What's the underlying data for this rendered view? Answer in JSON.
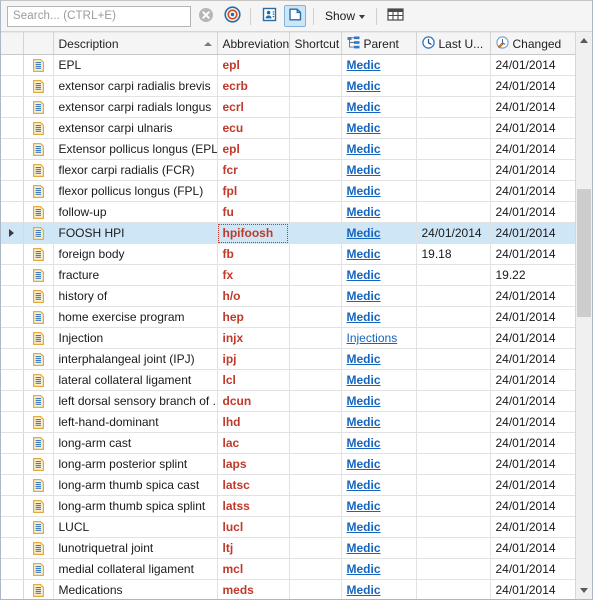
{
  "toolbar": {
    "search": {
      "placeholder": "Search... (CTRL+E)",
      "value": ""
    },
    "clear_icon": "clear-circle-icon",
    "target_icon": "target-icon",
    "contact_icon": "contact-card-icon",
    "document_icon": "document-folder-icon",
    "show_label": "Show",
    "columns_icon": "columns-grid-icon"
  },
  "grid": {
    "columns": [
      {
        "key": "indicator",
        "label": ""
      },
      {
        "key": "icon",
        "label": ""
      },
      {
        "key": "description",
        "label": "Description",
        "sorted": "asc"
      },
      {
        "key": "abbreviation",
        "label": "Abbreviation"
      },
      {
        "key": "shortcut",
        "label": "Shortcut"
      },
      {
        "key": "parent",
        "label": "Parent",
        "icon": "hierarchy-icon"
      },
      {
        "key": "last_updated",
        "label": "Last U...",
        "icon": "clock-icon"
      },
      {
        "key": "changed",
        "label": "Changed",
        "icon": "clock-edit-icon"
      }
    ],
    "rows": [
      {
        "description": "EPL",
        "abbreviation": "epl",
        "shortcut": "",
        "parent": "Medic",
        "last_updated": "",
        "changed": "24/01/2014",
        "selected": false
      },
      {
        "description": "extensor carpi radialis brevis",
        "abbreviation": "ecrb",
        "shortcut": "",
        "parent": "Medic",
        "last_updated": "",
        "changed": "24/01/2014",
        "selected": false
      },
      {
        "description": "extensor carpi radials longus",
        "abbreviation": "ecrl",
        "shortcut": "",
        "parent": "Medic",
        "last_updated": "",
        "changed": "24/01/2014",
        "selected": false
      },
      {
        "description": "extensor carpi ulnaris",
        "abbreviation": "ecu",
        "shortcut": "",
        "parent": "Medic",
        "last_updated": "",
        "changed": "24/01/2014",
        "selected": false
      },
      {
        "description": "Extensor pollicus longus (EPL)",
        "abbreviation": "epl",
        "shortcut": "",
        "parent": "Medic",
        "last_updated": "",
        "changed": "24/01/2014",
        "selected": false
      },
      {
        "description": "flexor carpi radialis (FCR)",
        "abbreviation": "fcr",
        "shortcut": "",
        "parent": "Medic",
        "last_updated": "",
        "changed": "24/01/2014",
        "selected": false
      },
      {
        "description": "flexor pollicus longus (FPL)",
        "abbreviation": "fpl",
        "shortcut": "",
        "parent": "Medic",
        "last_updated": "",
        "changed": "24/01/2014",
        "selected": false
      },
      {
        "description": "follow-up",
        "abbreviation": "fu",
        "shortcut": "",
        "parent": "Medic",
        "last_updated": "",
        "changed": "24/01/2014",
        "selected": false
      },
      {
        "description": "FOOSH HPI",
        "abbreviation": "hpifoosh",
        "shortcut": "",
        "parent": "Medic",
        "last_updated": "24/01/2014",
        "changed": "24/01/2014",
        "selected": true
      },
      {
        "description": "foreign body",
        "abbreviation": "fb",
        "shortcut": "",
        "parent": "Medic",
        "last_updated": "19.18",
        "changed": "24/01/2014",
        "selected": false
      },
      {
        "description": "fracture",
        "abbreviation": "fx",
        "shortcut": "",
        "parent": "Medic",
        "last_updated": "",
        "changed": "19.22",
        "selected": false
      },
      {
        "description": "history of",
        "abbreviation": "h/o",
        "shortcut": "",
        "parent": "Medic",
        "last_updated": "",
        "changed": "24/01/2014",
        "selected": false
      },
      {
        "description": "home exercise program",
        "abbreviation": "hep",
        "shortcut": "",
        "parent": "Medic",
        "last_updated": "",
        "changed": "24/01/2014",
        "selected": false
      },
      {
        "description": "Injection",
        "abbreviation": "injx",
        "shortcut": "",
        "parent": "Injections",
        "last_updated": "",
        "changed": "24/01/2014",
        "selected": false
      },
      {
        "description": "interphalangeal joint (IPJ)",
        "abbreviation": "ipj",
        "shortcut": "",
        "parent": "Medic",
        "last_updated": "",
        "changed": "24/01/2014",
        "selected": false
      },
      {
        "description": "lateral collateral ligament",
        "abbreviation": "lcl",
        "shortcut": "",
        "parent": "Medic",
        "last_updated": "",
        "changed": "24/01/2014",
        "selected": false
      },
      {
        "description": "left dorsal sensory branch of ...",
        "abbreviation": "dcun",
        "shortcut": "",
        "parent": "Medic",
        "last_updated": "",
        "changed": "24/01/2014",
        "selected": false
      },
      {
        "description": "left-hand-dominant",
        "abbreviation": "lhd",
        "shortcut": "",
        "parent": "Medic",
        "last_updated": "",
        "changed": "24/01/2014",
        "selected": false
      },
      {
        "description": "long-arm cast",
        "abbreviation": "lac",
        "shortcut": "",
        "parent": "Medic",
        "last_updated": "",
        "changed": "24/01/2014",
        "selected": false
      },
      {
        "description": "long-arm posterior splint",
        "abbreviation": "laps",
        "shortcut": "",
        "parent": "Medic",
        "last_updated": "",
        "changed": "24/01/2014",
        "selected": false
      },
      {
        "description": "long-arm thumb spica cast",
        "abbreviation": "latsc",
        "shortcut": "",
        "parent": "Medic",
        "last_updated": "",
        "changed": "24/01/2014",
        "selected": false
      },
      {
        "description": "long-arm thumb spica splint",
        "abbreviation": "latss",
        "shortcut": "",
        "parent": "Medic",
        "last_updated": "",
        "changed": "24/01/2014",
        "selected": false
      },
      {
        "description": "LUCL",
        "abbreviation": "lucl",
        "shortcut": "",
        "parent": "Medic",
        "last_updated": "",
        "changed": "24/01/2014",
        "selected": false
      },
      {
        "description": "lunotriquetral joint",
        "abbreviation": "ltj",
        "shortcut": "",
        "parent": "Medic",
        "last_updated": "",
        "changed": "24/01/2014",
        "selected": false
      },
      {
        "description": "medial collateral ligament",
        "abbreviation": "mcl",
        "shortcut": "",
        "parent": "Medic",
        "last_updated": "",
        "changed": "24/01/2014",
        "selected": false
      },
      {
        "description": "Medications",
        "abbreviation": "meds",
        "shortcut": "",
        "parent": "Medic",
        "last_updated": "",
        "changed": "24/01/2014",
        "selected": false
      }
    ]
  },
  "scrollbar": {
    "up_icon": "scroll-up-icon",
    "down_icon": "scroll-down-icon"
  },
  "colors": {
    "abbreviation_text": "#c0392b",
    "link": "#1565c0",
    "selection": "#cfe6f7",
    "header_bg": "#f5f5f5"
  }
}
